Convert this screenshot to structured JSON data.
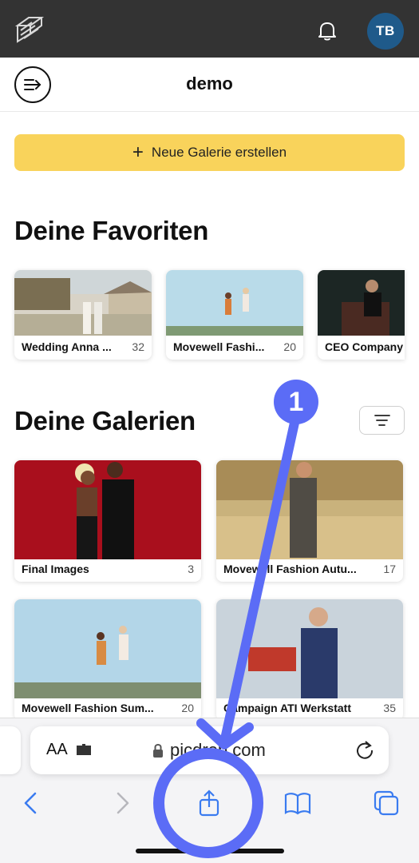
{
  "app": {
    "title": "demo",
    "avatar_initials": "TB",
    "logo_icon": "picdrop-logo-icon",
    "brand_color": "#333333",
    "accent_color": "#f9d35b"
  },
  "actions": {
    "create_gallery_label": "Neue Galerie erstellen",
    "create_gallery_icon": "plus-icon"
  },
  "favorites": {
    "title": "Deine Favoriten",
    "items": [
      {
        "label": "Wedding Anna ...",
        "count": "32"
      },
      {
        "label": "Movewell Fashi...",
        "count": "20"
      },
      {
        "label": "CEO Company",
        "count": ""
      }
    ]
  },
  "galleries": {
    "title": "Deine Galerien",
    "sort_icon": "sort-icon",
    "items": [
      {
        "label": "Final Images",
        "count": "3"
      },
      {
        "label": "Movewell Fashion Autu...",
        "count": "17"
      },
      {
        "label": "Movewell Fashion Sum...",
        "count": "20"
      },
      {
        "label": "Campaign ATI Werkstatt",
        "count": "35"
      }
    ]
  },
  "browser": {
    "text_size_label": "AA",
    "url": "picdrop.com",
    "icons": [
      "back-icon",
      "forward-icon",
      "share-icon",
      "bookmarks-icon",
      "tabs-icon",
      "reload-icon",
      "lock-icon"
    ]
  },
  "annotation": {
    "step_number": "1",
    "color": "#5b6cf6"
  }
}
